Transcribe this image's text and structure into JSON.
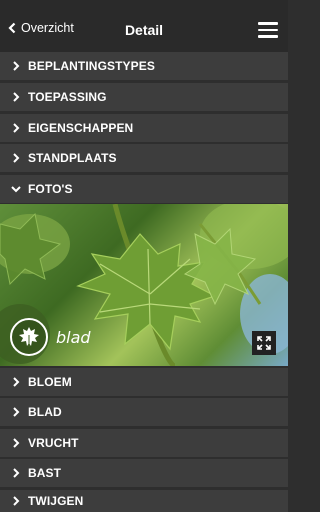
{
  "header": {
    "back_label": "Overzicht",
    "title": "Detail"
  },
  "sections_top": [
    {
      "label": "BEPLANTINGSTYPES",
      "state": "collapsed"
    },
    {
      "label": "TOEPASSING",
      "state": "collapsed"
    },
    {
      "label": "EIGENSCHAPPEN",
      "state": "collapsed"
    },
    {
      "label": "STANDPLAATS",
      "state": "collapsed"
    },
    {
      "label": "FOTO'S",
      "state": "expanded"
    }
  ],
  "photo": {
    "caption": "blad"
  },
  "sections_bottom": [
    {
      "label": "BLOEM"
    },
    {
      "label": "BLAD"
    },
    {
      "label": "VRUCHT"
    },
    {
      "label": "BAST"
    },
    {
      "label": "TWIJGEN"
    }
  ],
  "colors": {
    "header_bg": "#2a2a2a",
    "row_bg": "#3d3d3d",
    "divider": "#2e2e2e"
  }
}
